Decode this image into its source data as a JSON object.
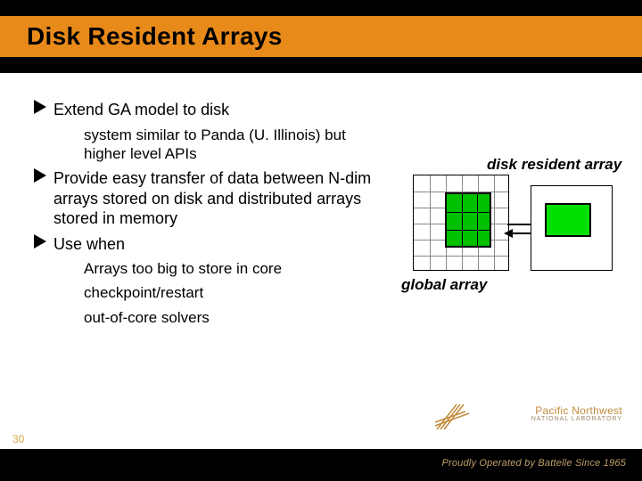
{
  "title": "Disk Resident Arrays",
  "bullets": {
    "b1": "Extend GA model to disk",
    "b1a": "system similar to Panda (U. Illinois) but higher level APIs",
    "b2": "Provide easy transfer of data between N-dim arrays stored on disk and  distributed arrays stored in memory",
    "b3": "Use when",
    "b3a": "Arrays too big to store in core",
    "b3b": "checkpoint/restart",
    "b3c": "out-of-core solvers"
  },
  "labels": {
    "disk_resident_array": "disk resident array",
    "global_array": "global array"
  },
  "footer": {
    "page": "30",
    "operated": "Proudly Operated by Battelle Since 1965",
    "lab_name": "Pacific Northwest",
    "lab_sub": "NATIONAL LABORATORY"
  }
}
